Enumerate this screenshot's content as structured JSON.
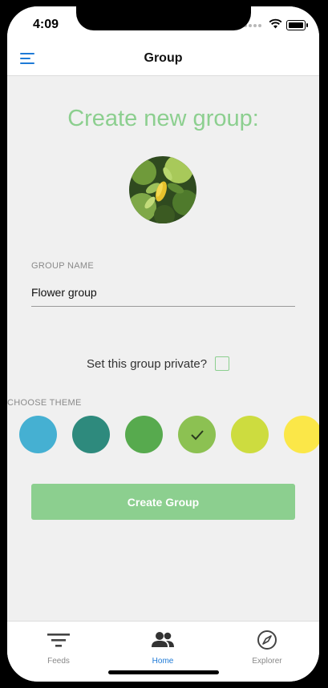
{
  "status_bar": {
    "time": "4:09"
  },
  "header": {
    "title": "Group",
    "menu_icon": "hamburger-icon"
  },
  "main": {
    "heading": "Create new group:",
    "group_name_label": "GROUP NAME",
    "group_name_value": "Flower group",
    "private_label": "Set this group private?",
    "private_checked": false,
    "choose_theme_label": "CHOOSE THEME",
    "themes": [
      {
        "color": "#45b0d2",
        "selected": false
      },
      {
        "color": "#2e8a7d",
        "selected": false
      },
      {
        "color": "#57aa4e",
        "selected": false
      },
      {
        "color": "#8cc152",
        "selected": true
      },
      {
        "color": "#cddc3f",
        "selected": false
      },
      {
        "color": "#fbe748",
        "selected": false
      }
    ],
    "create_button_label": "Create Group",
    "accent_color": "#8ccf8f"
  },
  "tabbar": {
    "tabs": [
      {
        "label": "Feeds",
        "icon": "filter-icon",
        "active": false
      },
      {
        "label": "Home",
        "icon": "people-icon",
        "active": true
      },
      {
        "label": "Explorer",
        "icon": "compass-icon",
        "active": false
      }
    ]
  }
}
